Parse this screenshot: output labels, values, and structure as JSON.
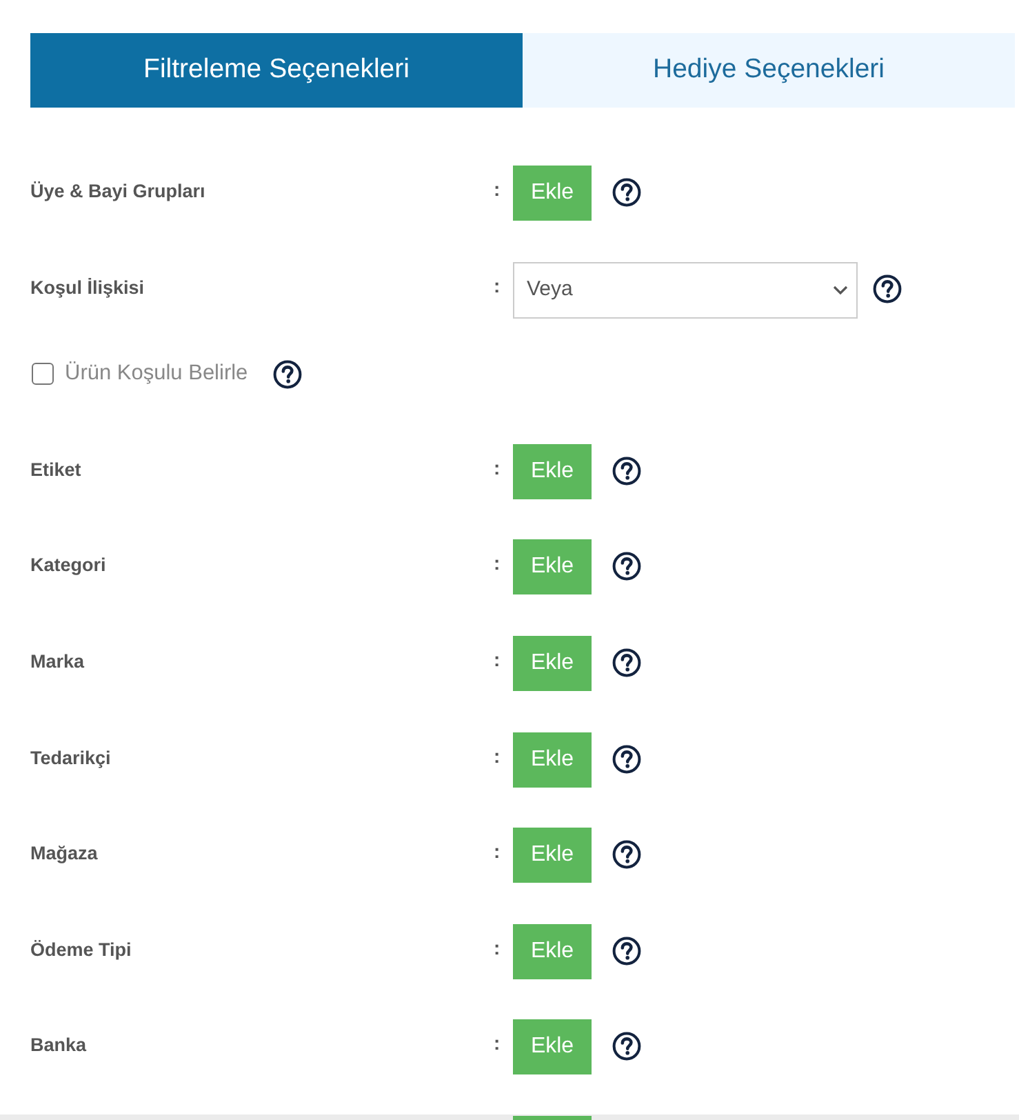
{
  "tabs": [
    {
      "label": "Filtreleme Seçenekleri",
      "selected": true
    },
    {
      "label": "Hediye Seçenekleri",
      "selected": false
    }
  ],
  "rows": [
    {
      "kind": "button",
      "label": "Üye & Bayi Grupları",
      "separator": ":",
      "button": "Ekle"
    },
    {
      "kind": "select",
      "label": "Koşul İlişkisi",
      "separator": ":",
      "value": "Veya"
    },
    {
      "kind": "checkbox",
      "label": "Ürün Koşulu Belirle",
      "checked": false
    },
    {
      "kind": "button",
      "label": "Etiket",
      "separator": ":",
      "button": "Ekle"
    },
    {
      "kind": "button",
      "label": "Kategori",
      "separator": ":",
      "button": "Ekle"
    },
    {
      "kind": "button",
      "label": "Marka",
      "separator": ":",
      "button": "Ekle"
    },
    {
      "kind": "button",
      "label": "Tedarikçi",
      "separator": ":",
      "button": "Ekle"
    },
    {
      "kind": "button",
      "label": "Mağaza",
      "separator": ":",
      "button": "Ekle"
    },
    {
      "kind": "button",
      "label": "Ödeme Tipi",
      "separator": ":",
      "button": "Ekle"
    },
    {
      "kind": "button",
      "label": "Banka",
      "separator": ":",
      "button": "Ekle"
    }
  ],
  "next_row_cut_off": true
}
